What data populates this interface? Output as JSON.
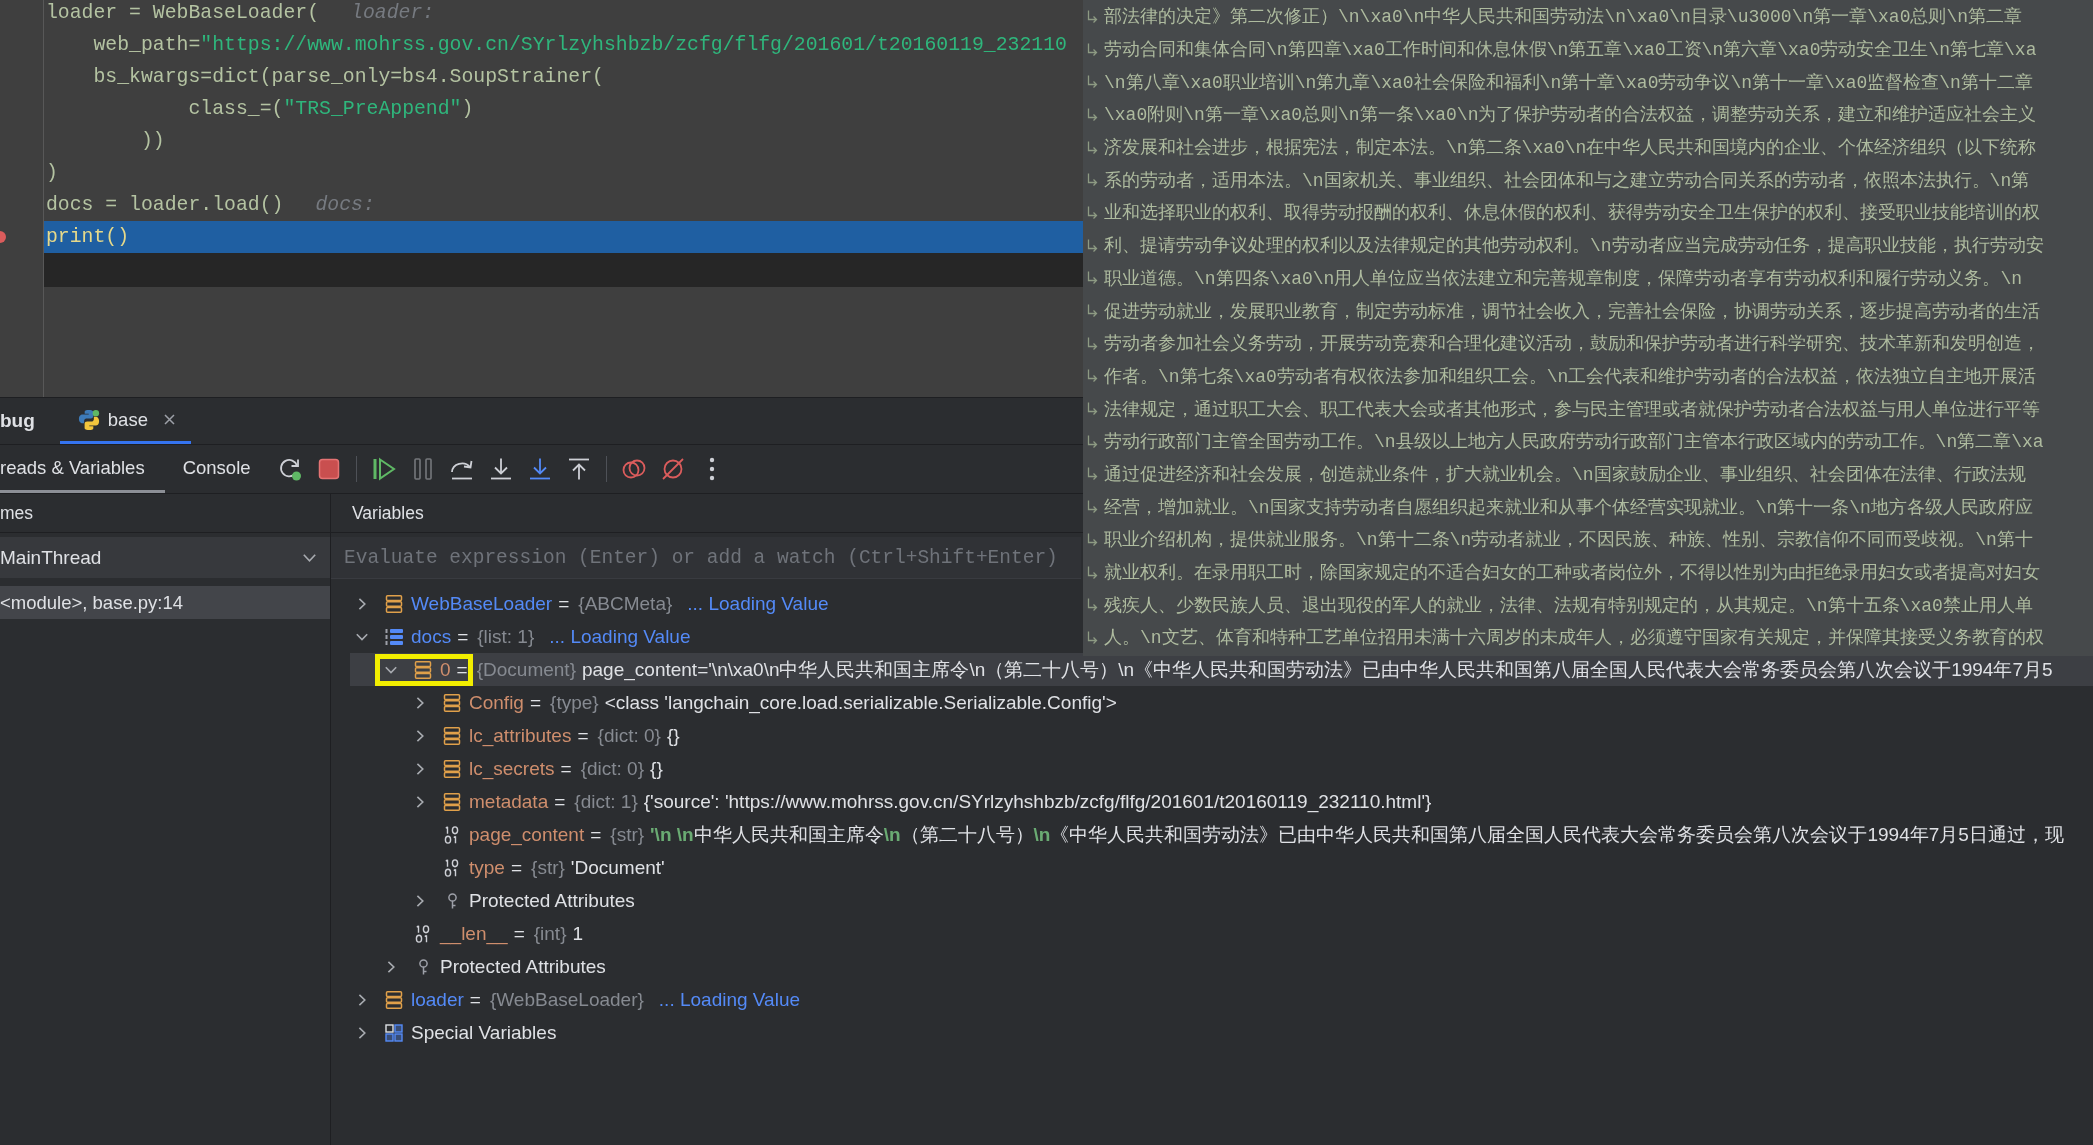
{
  "editor": {
    "lines": [
      {
        "tokens": [
          {
            "kind": "plain",
            "text": "loader = WebBaseLoader("
          }
        ],
        "hint": "loader:",
        "current": false,
        "breakpoint": false
      },
      {
        "tokens": [
          {
            "kind": "plain",
            "text": "    web_path="
          },
          {
            "kind": "string",
            "text": "\"https://www.mohrss.gov.cn/SYrlzyhshbzb/zcfg/flfg/201601/t20160119_232110"
          }
        ],
        "current": false,
        "breakpoint": false
      },
      {
        "tokens": [
          {
            "kind": "plain",
            "text": "    bs_kwargs=dict(parse_only=bs4.SoupStrainer("
          }
        ],
        "current": false,
        "breakpoint": false
      },
      {
        "tokens": [
          {
            "kind": "plain",
            "text": "            class_=("
          },
          {
            "kind": "string",
            "text": "\"TRS_PreAppend\""
          },
          {
            "kind": "plain",
            "text": ")"
          }
        ],
        "current": false,
        "breakpoint": false
      },
      {
        "tokens": [
          {
            "kind": "plain",
            "text": "        ))"
          }
        ],
        "current": false,
        "breakpoint": false
      },
      {
        "tokens": [
          {
            "kind": "plain",
            "text": ")"
          }
        ],
        "current": false,
        "breakpoint": false
      },
      {
        "tokens": [
          {
            "kind": "plain",
            "text": "docs = loader.load()"
          }
        ],
        "hint": "docs:",
        "current": false,
        "breakpoint": false
      },
      {
        "tokens": [
          {
            "kind": "plain",
            "text": "print()"
          }
        ],
        "current": true,
        "breakpoint": true
      }
    ]
  },
  "value_popup": {
    "lines": [
      "部法律的决定》第二次修正）\\n\\xa0\\n中华人民共和国劳动法\\n\\xa0\\n目录\\u3000\\n第一章\\xa0总则\\n第二章",
      "劳动合同和集体合同\\n第四章\\xa0工作时间和休息休假\\n第五章\\xa0工资\\n第六章\\xa0劳动安全卫生\\n第七章\\xa",
      "\\n第八章\\xa0职业培训\\n第九章\\xa0社会保险和福利\\n第十章\\xa0劳动争议\\n第十一章\\xa0监督检查\\n第十二章",
      "\\xa0附则\\n第一章\\xa0总则\\n第一条\\xa0\\n为了保护劳动者的合法权益，调整劳动关系，建立和维护适应社会主义",
      "济发展和社会进步，根据宪法，制定本法。\\n第二条\\xa0\\n在中华人民共和国境内的企业、个体经济组织（以下统称",
      "系的劳动者，适用本法。\\n国家机关、事业组织、社会团体和与之建立劳动合同关系的劳动者，依照本法执行。\\n第",
      "业和选择职业的权利、取得劳动报酬的权利、休息休假的权利、获得劳动安全卫生保护的权利、接受职业技能培训的权",
      "利、提请劳动争议处理的权利以及法律规定的其他劳动权利。\\n劳动者应当完成劳动任务，提高职业技能，执行劳动安",
      "职业道德。\\n第四条\\xa0\\n用人单位应当依法建立和完善规章制度，保障劳动者享有劳动权利和履行劳动义务。\\n",
      "促进劳动就业，发展职业教育，制定劳动标准，调节社会收入，完善社会保险，协调劳动关系，逐步提高劳动者的生活",
      "劳动者参加社会义务劳动，开展劳动竞赛和合理化建议活动，鼓励和保护劳动者进行科学研究、技术革新和发明创造，",
      "作者。\\n第七条\\xa0劳动者有权依法参加和组织工会。\\n工会代表和维护劳动者的合法权益，依法独立自主地开展活",
      "法律规定，通过职工大会、职工代表大会或者其他形式，参与民主管理或者就保护劳动者合法权益与用人单位进行平等",
      "劳动行政部门主管全国劳动工作。\\n县级以上地方人民政府劳动行政部门主管本行政区域内的劳动工作。\\n第二章\\xa",
      "通过促进经济和社会发展，创造就业条件，扩大就业机会。\\n国家鼓励企业、事业组织、社会团体在法律、行政法规",
      "经营，增加就业。\\n国家支持劳动者自愿组织起来就业和从事个体经营实现就业。\\n第十一条\\n地方各级人民政府应",
      "职业介绍机构，提供就业服务。\\n第十二条\\n劳动者就业，不因民族、种族、性别、宗教信仰不同而受歧视。\\n第十",
      "就业权利。在录用职工时，除国家规定的不适合妇女的工种或者岗位外，不得以性别为由拒绝录用妇女或者提高对妇女",
      "残疾人、少数民族人员、退出现役的军人的就业，法律、法规有特别规定的，从其规定。\\n第十五条\\xa0禁止用人单",
      "人。\\n文艺、体育和特种工艺单位招用未满十六周岁的未成年人，必须遵守国家有关规定，并保障其接受义务教育的权"
    ]
  },
  "debug": {
    "title": "bug",
    "sessions": [
      {
        "label": "base",
        "selected": true
      }
    ],
    "tabs": [
      {
        "label": "reads & Variables",
        "selected": true
      },
      {
        "label": "Console",
        "selected": false
      }
    ],
    "toolbar": [
      [
        {
          "kind": "rerun",
          "disabled": false
        },
        {
          "kind": "stop",
          "disabled": false
        }
      ],
      [
        {
          "kind": "resume",
          "disabled": false
        },
        {
          "kind": "pause",
          "disabled": true
        },
        {
          "kind": "step-over",
          "disabled": false
        },
        {
          "kind": "step-into",
          "disabled": false
        },
        {
          "kind": "step-into-my-code",
          "disabled": false
        },
        {
          "kind": "step-out",
          "disabled": false
        }
      ],
      [
        {
          "kind": "breakpoints",
          "disabled": false
        },
        {
          "kind": "mute-breakpoints",
          "disabled": false
        },
        {
          "kind": "more",
          "disabled": false
        }
      ]
    ],
    "frames_header": "mes",
    "thread": "MainThread",
    "frames": [
      {
        "label": "<module>, base.py:14",
        "selected": true
      }
    ],
    "variables_header": "Variables",
    "evaluate": {
      "placeholder": "Evaluate expression (Enter) or add a watch (Ctrl+Shift+Enter)"
    },
    "variables": [
      {
        "kind": "object",
        "name": "WebBaseLoader",
        "operator": "=",
        "type": "{ABCMeta}",
        "status": "... Loading Value",
        "expanded": false,
        "selected": false,
        "highlighted": false
      },
      {
        "kind": "list",
        "name": "docs",
        "operator": "=",
        "type": "{list: 1}",
        "status": "... Loading Value",
        "expanded": true,
        "selected": false,
        "highlighted": false,
        "children": [
          {
            "kind": "object",
            "name": "0",
            "operator": "=",
            "type": "{Document}",
            "value": "page_content='\\n\\xa0\\n中华人民共和国主席令\\n（第二十八号）\\n《中华人民共和国劳动法》已由中华人民共和国第八届全国人民代表大会常务委员会第八次会议于1994年7月5",
            "expanded": true,
            "selected": true,
            "highlighted": true,
            "children": [
              {
                "kind": "object",
                "name": "Config",
                "operator": "=",
                "type": "{type}",
                "value": "<class 'langchain_core.load.serializable.Serializable.Config'>",
                "expanded": false,
                "selected": false,
                "highlighted": false
              },
              {
                "kind": "object",
                "name": "lc_attributes",
                "operator": "=",
                "type": "{dict: 0}",
                "value": "{}",
                "expanded": false,
                "selected": false,
                "highlighted": false
              },
              {
                "kind": "object",
                "name": "lc_secrets",
                "operator": "=",
                "type": "{dict: 0}",
                "value": "{}",
                "expanded": false,
                "selected": false,
                "highlighted": false
              },
              {
                "kind": "object",
                "name": "metadata",
                "operator": "=",
                "type": "{dict: 1}",
                "value": "{'source': 'https://www.mohrss.gov.cn/SYrlzyhshbzb/zcfg/flfg/201601/t20160119_232110.html'}",
                "expanded": false,
                "selected": false,
                "highlighted": false
              },
              {
                "kind": "primitive",
                "name": "page_content",
                "operator": "=",
                "type": "{str}",
                "value": "**'\\n \\n**中华人民共和国主席令**\\n**（第二十八号）**\\n**《中华人民共和国劳动法》已由中华人民共和国第八届全国人民代表大会常务委员会第八次会议于1994年7月5日通过，现",
                "selected": false,
                "highlighted": false
              },
              {
                "kind": "primitive",
                "name": "type",
                "operator": "=",
                "type": "{str}",
                "value": "'Document'",
                "selected": false,
                "highlighted": false
              },
              {
                "kind": "protected",
                "name": "Protected Attributes",
                "expanded": false,
                "selected": false,
                "highlighted": false
              }
            ]
          },
          {
            "kind": "primitive",
            "name": "__len__",
            "operator": "=",
            "type": "{int}",
            "value": "1",
            "selected": false,
            "highlighted": false
          },
          {
            "kind": "protected",
            "name": "Protected Attributes",
            "expanded": false,
            "selected": false,
            "highlighted": false
          }
        ]
      },
      {
        "kind": "object",
        "name": "loader",
        "operator": "=",
        "type": "{WebBaseLoader}",
        "status": "... Loading Value",
        "expanded": false,
        "selected": false,
        "highlighted": false
      },
      {
        "kind": "special",
        "name": "Special Variables",
        "expanded": false,
        "selected": false,
        "highlighted": false
      }
    ]
  }
}
